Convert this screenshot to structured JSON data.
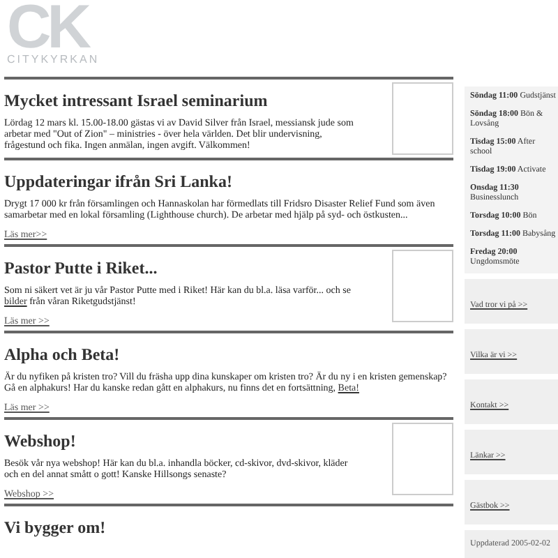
{
  "logo": {
    "mark": "CK",
    "name": "CITYKYRKAN"
  },
  "articles": [
    {
      "title": "Mycket intressant Israel seminarium",
      "body": [
        {
          "kind": "text",
          "text": "Lördag 12 mars kl. 15.00-18.00 gästas vi av David Silver från Israel, messiansk jude som arbetar med \"Out of Zion\" – ministries - över hela världen. Det blir undervisning, frågestund och fika. Ingen anmälan, ingen avgift. Välkommen!"
        }
      ],
      "image": true
    },
    {
      "title": "Uppdateringar ifrån Sri Lanka!",
      "body": [
        {
          "kind": "text",
          "text": "Drygt 17 000 kr från församlingen och Hannaskolan har förmedlats till Fridsro Disaster Relief Fund som även samarbetar med en lokal församling (Lighthouse church). De arbetar med hjälp på syd- och östkusten..."
        }
      ],
      "more": "Läs mer>>",
      "image": false
    },
    {
      "title": "Pastor Putte i Riket...",
      "body": [
        {
          "kind": "text",
          "text": "Som ni säkert vet är ju vår Pastor Putte med i Riket! Här kan du bl.a. läsa varför... och se "
        },
        {
          "kind": "link",
          "text": "bilder"
        },
        {
          "kind": "text",
          "text": " från våran Riketgudstjänst!"
        }
      ],
      "more": "Läs mer >>",
      "image": true
    },
    {
      "title": "Alpha och Beta!",
      "body": [
        {
          "kind": "text",
          "text": "Är du nyfiken på kristen tro? Vill du fräsha upp dina kunskaper om kristen tro? Är du ny i en kristen gemenskap? Gå en alphakurs! Har du kanske redan gått en alphakurs, nu finns det en fortsättning, "
        },
        {
          "kind": "link",
          "text": "Beta!"
        }
      ],
      "more": "Läs mer >>",
      "image": false
    },
    {
      "title": "Webshop!",
      "body": [
        {
          "kind": "text",
          "text": "Besök vår nya webshop! Här kan du bl.a. inhandla böcker, cd-skivor, dvd-skivor, kläder och en del annat smått o gott! Kanske Hillsongs senaste?"
        }
      ],
      "more": "Webshop >>",
      "image": true
    },
    {
      "title": "Vi bygger om!",
      "image": false
    }
  ],
  "schedule": [
    {
      "when": "Söndag 11:00",
      "what": "Gudstjänst"
    },
    {
      "when": "Söndag 18:00",
      "what": "Bön & Lovsång"
    },
    {
      "when": "Tisdag 15:00",
      "what": "After school"
    },
    {
      "when": "Tisdag 19:00",
      "what": "Activate"
    },
    {
      "when": "Onsdag 11:30",
      "what": "Businesslunch"
    },
    {
      "when": "Torsdag 10:00",
      "what": "Bön"
    },
    {
      "when": "Torsdag 11:00",
      "what": "Babysång"
    },
    {
      "when": "Fredag 20:00",
      "what": "Ungdomsmöte"
    }
  ],
  "links": [
    "Vad tror vi på >>",
    "Vilka är vi >>",
    "Kontakt >>",
    "Länkar >>",
    "Gästbok >>"
  ],
  "updated": "Uppdaterad 2005-02-02"
}
